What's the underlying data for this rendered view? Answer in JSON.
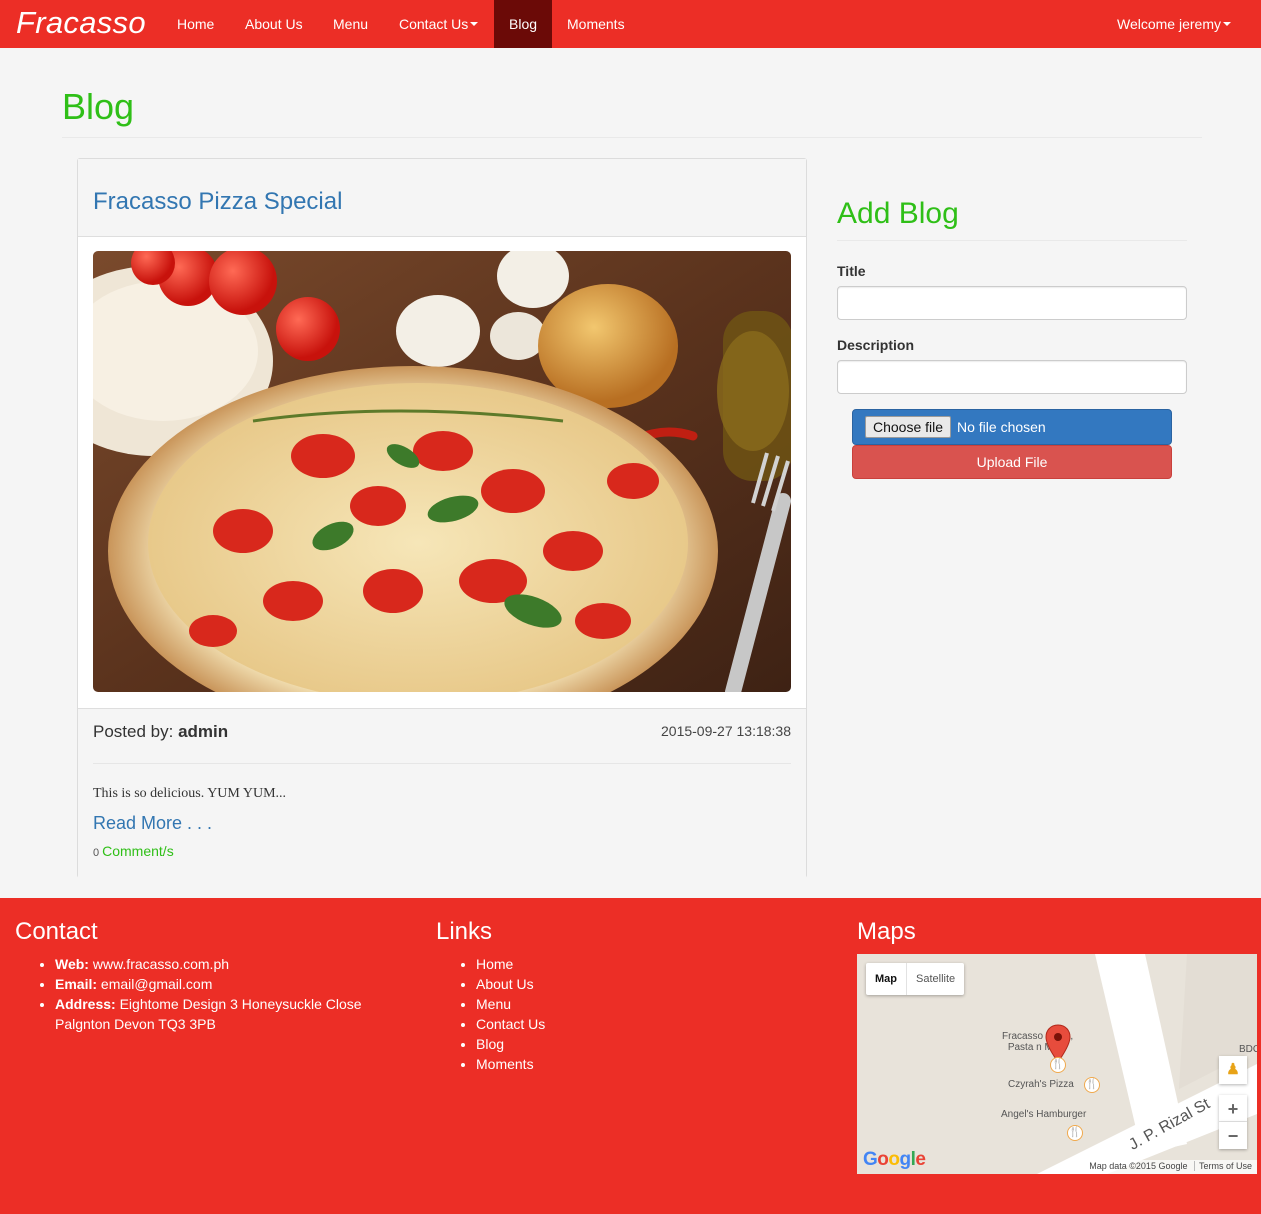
{
  "navbar": {
    "brand": "Fracasso",
    "items": [
      {
        "label": "Home"
      },
      {
        "label": "About Us"
      },
      {
        "label": "Menu"
      },
      {
        "label": "Contact Us"
      },
      {
        "label": "Blog"
      },
      {
        "label": "Moments"
      }
    ],
    "active": "Blog",
    "user": "Welcome jeremy",
    "color": "#ec2e26",
    "active_color": "#6b0a07"
  },
  "page": {
    "title": "Blog",
    "title_color": "#2fbf17"
  },
  "post": {
    "title": "Fracasso Pizza Special",
    "image_icon": "pizza-photo",
    "posted_by_label": "Posted by:",
    "author": "admin",
    "date": "2015-09-27 13:18:38",
    "description": "This is so delicious. YUM YUM...",
    "read_more": "Read More . . .",
    "comment_count": "0",
    "comment_label": "Comment/s"
  },
  "add_blog": {
    "heading": "Add Blog",
    "title_label": "Title",
    "title_value": "",
    "description_label": "Description",
    "description_value": "",
    "choose_file": "Choose file",
    "file_status": "No file chosen",
    "upload_label": "Upload File"
  },
  "footer": {
    "contact_heading": "Contact",
    "contact": {
      "web_label": "Web:",
      "web": "www.fracasso.com.ph",
      "email_label": "Email:",
      "email": "email@gmail.com",
      "address_label": "Address:",
      "address": "Eightome Design 3 Honeysuckle Close Palgnton Devon TQ3 3PB"
    },
    "links_heading": "Links",
    "links": [
      "Home",
      "About Us",
      "Menu",
      "Contact Us",
      "Blog",
      "Moments"
    ],
    "maps_heading": "Maps"
  },
  "map": {
    "tab_map": "Map",
    "tab_satellite": "Satellite",
    "place_1_line_1": "Fracasso Pizza,",
    "place_1_line_2": "Pasta n More",
    "place_2": "Czyrah's Pizza",
    "place_3": "Angel's Hamburger",
    "street": "J. P. Rizal St",
    "edge_label": "BDO",
    "logo": "Google",
    "attribution": "Map data ©2015 Google",
    "terms": "Terms of Use",
    "zoom_in": "+",
    "zoom_out": "−"
  }
}
